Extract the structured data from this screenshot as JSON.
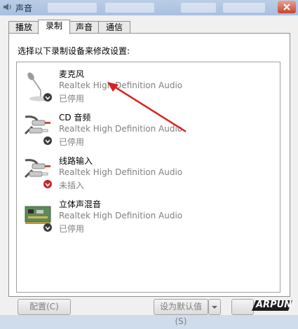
{
  "window": {
    "title": "声音"
  },
  "tabs": [
    {
      "label": "播放"
    },
    {
      "label": "录制"
    },
    {
      "label": "声音"
    },
    {
      "label": "通信"
    }
  ],
  "instruction": "选择以下录制设备来修改设置:",
  "devices": [
    {
      "name": "麦克风",
      "driver": "Realtek High Definition Audio",
      "status": "已停用",
      "icon": "microphone-icon",
      "badge": "disabled"
    },
    {
      "name": "CD 音频",
      "driver": "Realtek High Definition Audio",
      "status": "已停用",
      "icon": "rca-cable-icon",
      "badge": "disabled"
    },
    {
      "name": "线路输入",
      "driver": "Realtek High Definition Audio",
      "status": "未插入",
      "icon": "rca-cable-icon",
      "badge": "unplugged"
    },
    {
      "name": "立体声混音",
      "driver": "Realtek High Definition Audio",
      "status": "已停用",
      "icon": "sound-card-icon",
      "badge": "disabled"
    }
  ],
  "buttons": {
    "configure": "配置(C)",
    "set_default": "设为默认值(S)"
  },
  "watermark": "ARPUN",
  "colors": {
    "annotation_arrow": "#d92020",
    "unplugged_badge": "#c0282d",
    "disabled_badge": "#3a3a3a"
  }
}
